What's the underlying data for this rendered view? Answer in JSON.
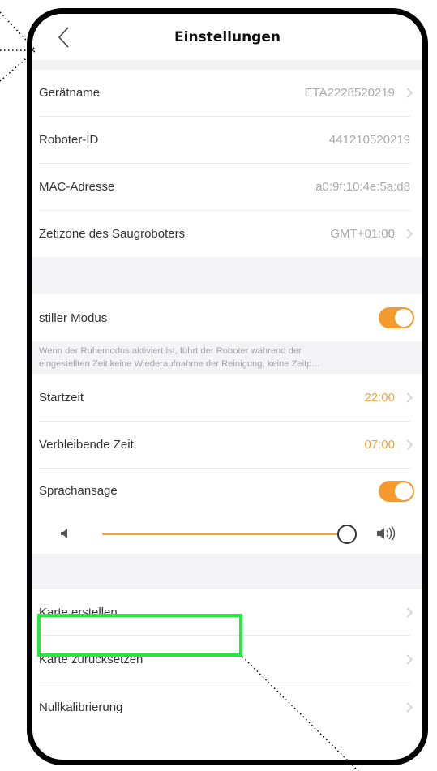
{
  "header": {
    "title": "Einstellungen",
    "back_icon": "chevron-left-icon"
  },
  "device": [
    {
      "label": "Gerätname",
      "value": "ETA2228520219",
      "has_arrow": true
    },
    {
      "label": "Roboter-ID",
      "value": "441210520219",
      "has_arrow": false
    },
    {
      "label": "MAC-Adresse",
      "value": "a0:9f:10:4e:5a:d8",
      "has_arrow": false
    },
    {
      "label": "Zetizone des Saugroboters",
      "value": "GMT+01:00",
      "has_arrow": true
    }
  ],
  "quiet_mode": {
    "label": "stiller Modus",
    "enabled": true,
    "description_line1": "Wenn der Ruhemodus aktiviert ist, führt der Roboter während der",
    "description_line2": "eingestellten Zeit keine Wiederaufnahme der Reinigung, keine Zeitp...",
    "start_label": "Startzeit",
    "start_value": "22:00",
    "end_label": "Verbleibende Zeit",
    "end_value": "07:00"
  },
  "voice": {
    "label": "Sprachansage",
    "enabled": true,
    "volume_fraction": 1.0,
    "volume_low_icon": "speaker-low-icon",
    "volume_high_icon": "speaker-high-icon"
  },
  "map": [
    {
      "label": "Karte erstellen"
    },
    {
      "label": "Karte zurücksetzen"
    },
    {
      "label": "Nullkalibrierung"
    }
  ],
  "colors": {
    "accent": "#f5a236",
    "highlight": "#27e83d"
  }
}
